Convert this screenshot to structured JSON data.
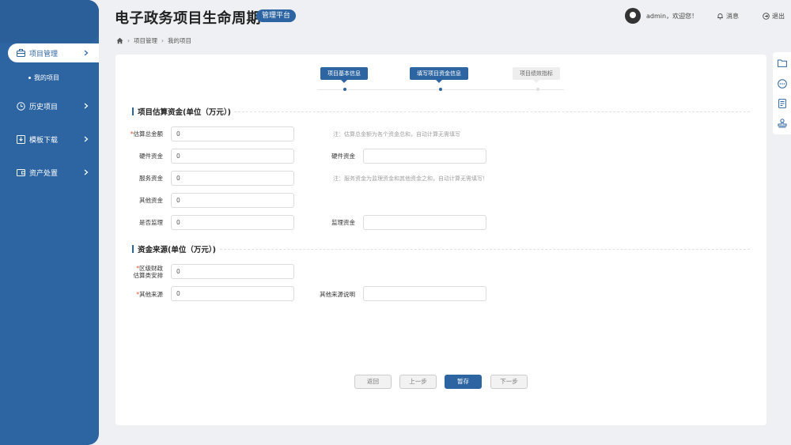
{
  "app": {
    "title": "电子政务项目生命周期",
    "badge": "管理平台"
  },
  "header": {
    "user_text": "admin，欢迎您！",
    "messages": "消息",
    "logout": "退出"
  },
  "sidebar": {
    "items": [
      {
        "label": "项目管理",
        "icon": "briefcase-icon",
        "active": true
      },
      {
        "label": "历史项目",
        "icon": "clock-icon",
        "active": false
      },
      {
        "label": "模板下载",
        "icon": "download-icon",
        "active": false
      },
      {
        "label": "资产处置",
        "icon": "wallet-icon",
        "active": false
      }
    ],
    "sub_item": "我的项目"
  },
  "breadcrumb": {
    "level1": "项目管理",
    "level2": "我的项目"
  },
  "steps": [
    {
      "label": "项目基本信息",
      "state": "done"
    },
    {
      "label": "填写项目资金信息",
      "state": "current"
    },
    {
      "label": "项目绩效指标",
      "state": "todo"
    }
  ],
  "section1": {
    "title": "项目估算资金(单位（万元）)",
    "total": {
      "label": "估算总金额",
      "value": "0",
      "note": "注：估算总金额为各个资金总和，自动计算无需填写"
    },
    "hardware": {
      "label": "硬件资金",
      "value": "0",
      "label2": "硬件资金",
      "value2": ""
    },
    "service": {
      "label": "服务资金",
      "value": "0",
      "note": "注：服务资金为监理资金和其他资金之和，自动计算无需填写！"
    },
    "other": {
      "label": "其他资金",
      "value": "0"
    },
    "supervision": {
      "label": "是否监理",
      "value": "0",
      "label2": "监理资金",
      "value2": ""
    }
  },
  "section2": {
    "title": "资金来源(单位（万元）)",
    "district": {
      "label_line1": "区级财政",
      "label_line2": "估算类安排",
      "value": "0"
    },
    "other_source": {
      "label": "其他来源",
      "value": "0",
      "label2": "其他来源说明",
      "value2": ""
    }
  },
  "buttons": {
    "back": "返回",
    "prev": "上一步",
    "save": "暂存",
    "next": "下一步"
  },
  "colors": {
    "primary": "#2d65a2",
    "required": "#e34d2c",
    "background": "#eef0f3"
  },
  "rail_icons": [
    "folder-icon",
    "more-icon",
    "document-icon",
    "stamp-icon"
  ]
}
